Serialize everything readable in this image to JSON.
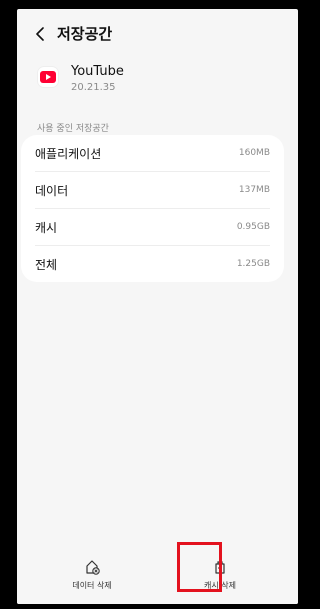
{
  "header": {
    "title": "저장공간"
  },
  "app": {
    "name": "YouTube",
    "version": "20.21.35"
  },
  "section": {
    "label": "사용 중인 저장공간"
  },
  "storage": [
    {
      "label": "애플리케이션",
      "value": "160MB"
    },
    {
      "label": "데이터",
      "value": "137MB"
    },
    {
      "label": "캐시",
      "value": "0.95GB"
    },
    {
      "label": "전체",
      "value": "1.25GB"
    }
  ],
  "actions": {
    "clear_data": "데이터 삭제",
    "clear_cache": "캐시 삭제"
  },
  "colors": {
    "youtube_red": "#ff0033",
    "highlight": "#e3121e",
    "background": "#f6f6f6"
  },
  "icons": [
    "back-arrow-icon",
    "youtube-icon",
    "clear-data-icon",
    "clear-cache-icon"
  ]
}
